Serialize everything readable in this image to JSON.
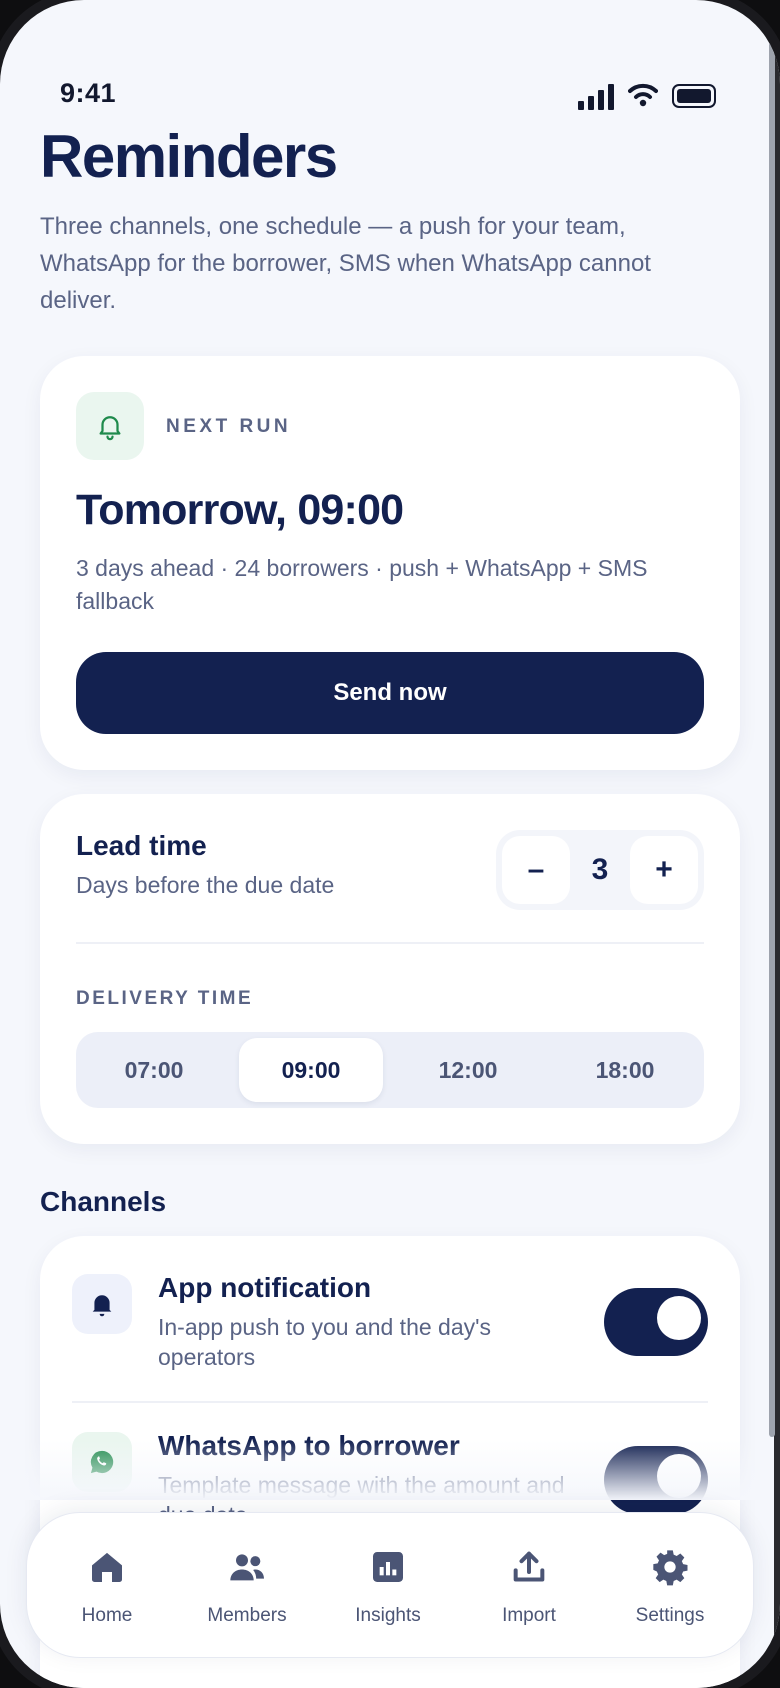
{
  "status_bar": {
    "time": "9:41"
  },
  "header": {
    "title": "Reminders",
    "description": "Three channels, one schedule — a push for your team, WhatsApp for the borrower, SMS when WhatsApp cannot deliver."
  },
  "next_run": {
    "label": "NEXT RUN",
    "title": "Tomorrow, 09:00",
    "meta": "3 days ahead · 24 borrowers · push + WhatsApp + SMS fallback",
    "send_button": "Send now"
  },
  "lead_time": {
    "title": "Lead time",
    "subtitle": "Days before the due date",
    "minus": "–",
    "value": "3",
    "plus": "+"
  },
  "delivery_time": {
    "label": "DELIVERY TIME",
    "options": [
      "07:00",
      "09:00",
      "12:00",
      "18:00"
    ],
    "selected": "09:00"
  },
  "channels": {
    "heading": "Channels",
    "items": [
      {
        "title": "App notification",
        "description": "In-app push to you and the day's operators",
        "icon": "bell-icon",
        "enabled": true
      },
      {
        "title": "WhatsApp to borrower",
        "description": "Template message with the amount and due date",
        "icon": "whatsapp-icon",
        "enabled": true
      }
    ]
  },
  "tab_bar": {
    "items": [
      {
        "label": "Home",
        "icon": "home-icon"
      },
      {
        "label": "Members",
        "icon": "members-icon"
      },
      {
        "label": "Insights",
        "icon": "insights-icon"
      },
      {
        "label": "Import",
        "icon": "import-icon"
      },
      {
        "label": "Settings",
        "icon": "settings-icon"
      }
    ]
  },
  "colors": {
    "primary": "#132150",
    "background": "#f5f7fc",
    "muted_text": "#5a6485",
    "accent_green": "#1f8a4c"
  }
}
